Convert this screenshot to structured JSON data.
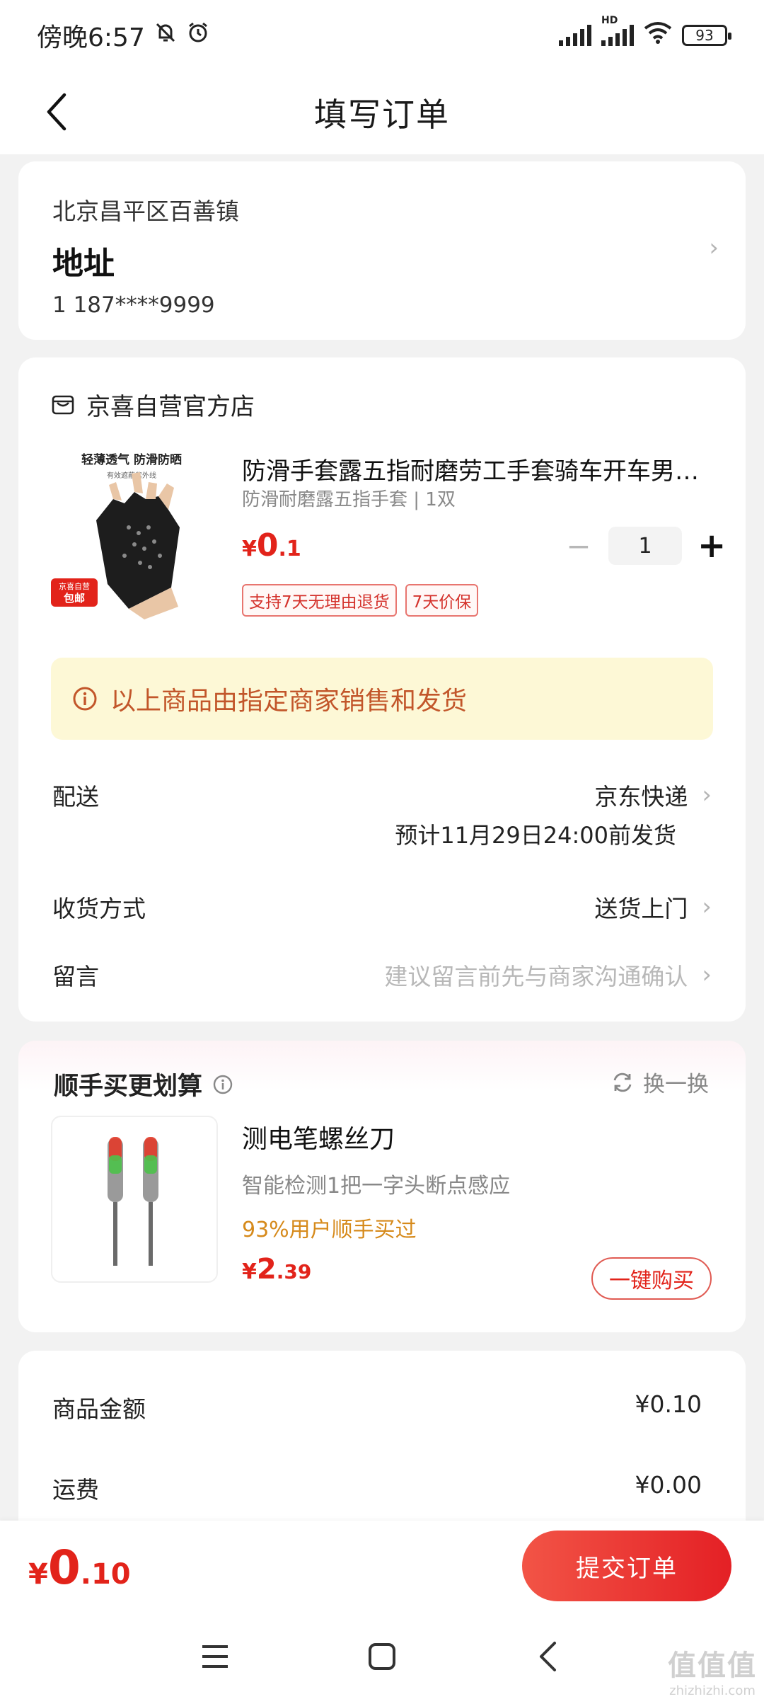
{
  "status_bar": {
    "time": "傍晚6:57",
    "battery": "93",
    "hd_label": "HD"
  },
  "header": {
    "title": "填写订单"
  },
  "address": {
    "region": "北京昌平区百善镇",
    "detail": "地址",
    "contact": "1  187****9999"
  },
  "store": {
    "name": "京喜自营官方店",
    "product": {
      "title": "防滑手套露五指耐磨劳工手套骑车开车男…",
      "spec": "防滑耐磨露五指手套 | 1双",
      "price_currency": "¥",
      "price_int": "0",
      "price_dec": ".1",
      "quantity": "1",
      "tags": [
        "支持7天无理由退货",
        "7天价保"
      ],
      "image_caption_top": "轻薄透气 防滑防晒",
      "image_caption_sub": "有效遮蔽紫外线",
      "image_badge_top": "京喜自营",
      "image_badge_bottom": "包邮"
    },
    "notice": "以上商品由指定商家销售和发货",
    "delivery": {
      "label": "配送",
      "value": "京东快递",
      "sub": "预计11月29日24:00前发货"
    },
    "receive": {
      "label": "收货方式",
      "value": "送货上门"
    },
    "message": {
      "label": "留言",
      "placeholder": "建议留言前先与商家沟通确认"
    }
  },
  "recommend": {
    "title": "顺手买更划算",
    "swap_label": "换一换",
    "item": {
      "name": "测电笔螺丝刀",
      "desc": "智能检测1把一字头断点感应",
      "stat": "93%用户顺手买过",
      "price_currency": "¥",
      "price_int": "2",
      "price_dec": ".39",
      "buy_label": "一键购买"
    }
  },
  "amounts": {
    "goods_label": "商品金额",
    "goods_value": "¥0.10",
    "shipping_label": "运费",
    "shipping_value": "¥0.00"
  },
  "footer": {
    "total_currency": "¥",
    "total_int": "0",
    "total_dec": ".10",
    "submit_label": "提交订单"
  },
  "watermark": {
    "text": "值值值",
    "url": "zhizhizhi.com"
  },
  "colors": {
    "accent": "#e2231a",
    "notice_bg": "#fdf8d6",
    "notice_text": "#c2562a",
    "stat_text": "#d68a1b"
  }
}
